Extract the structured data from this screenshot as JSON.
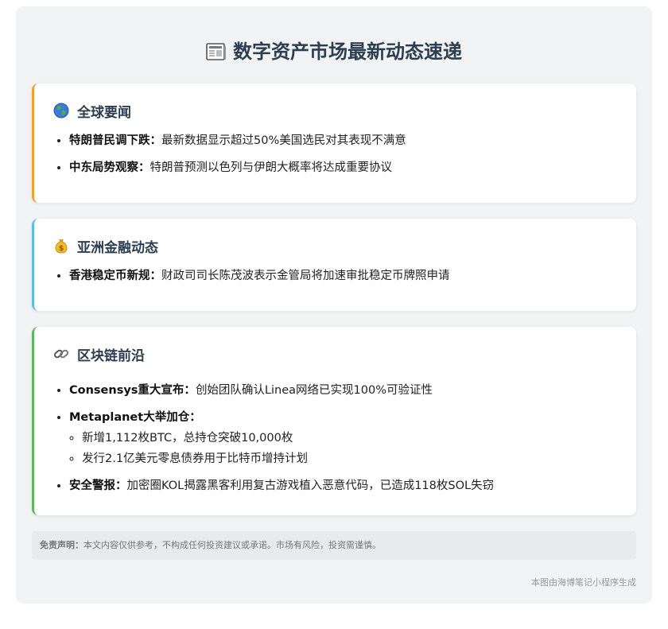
{
  "header": {
    "title": "数字资产市场最新动态速递",
    "icon": "newspaper-icon"
  },
  "sections": [
    {
      "title": "全球要闻",
      "icon": "globe-icon",
      "accent": "#f0a030",
      "items": [
        {
          "label": "特朗普民调下跌：",
          "text": "最新数据显示超过50%美国选民对其表现不满意"
        },
        {
          "label": "中东局势观察：",
          "text": "特朗普预测以色列与伊朗大概率将达成重要协议"
        }
      ]
    },
    {
      "title": "亚洲金融动态",
      "icon": "money-bag-icon",
      "accent": "#5bc0de",
      "items": [
        {
          "label": "香港稳定币新规：",
          "text": "财政司司长陈茂波表示金管局将加速审批稳定币牌照申请"
        }
      ]
    },
    {
      "title": "区块链前沿",
      "icon": "chain-link-icon",
      "accent": "#5cb85c",
      "items": [
        {
          "label": "Consensys重大宣布：",
          "text": "创始团队确认Linea网络已实现100%可验证性"
        },
        {
          "label": "Metaplanet大举加仓：",
          "sub": [
            "新增1,112枚BTC，总持仓突破10,000枚",
            "发行2.1亿美元零息债券用于比特币增持计划"
          ]
        },
        {
          "label": "安全警报：",
          "text": "加密圈KOL揭露黑客利用复古游戏植入恶意代码，已造成118枚SOL失窃"
        }
      ]
    }
  ],
  "disclaimer": {
    "label": "免责声明：",
    "text": "本文内容仅供参考，不构成任何投资建议或承诺。市场有风险，投资需谨慎。"
  },
  "footer": "本图由海博笔记小程序生成"
}
